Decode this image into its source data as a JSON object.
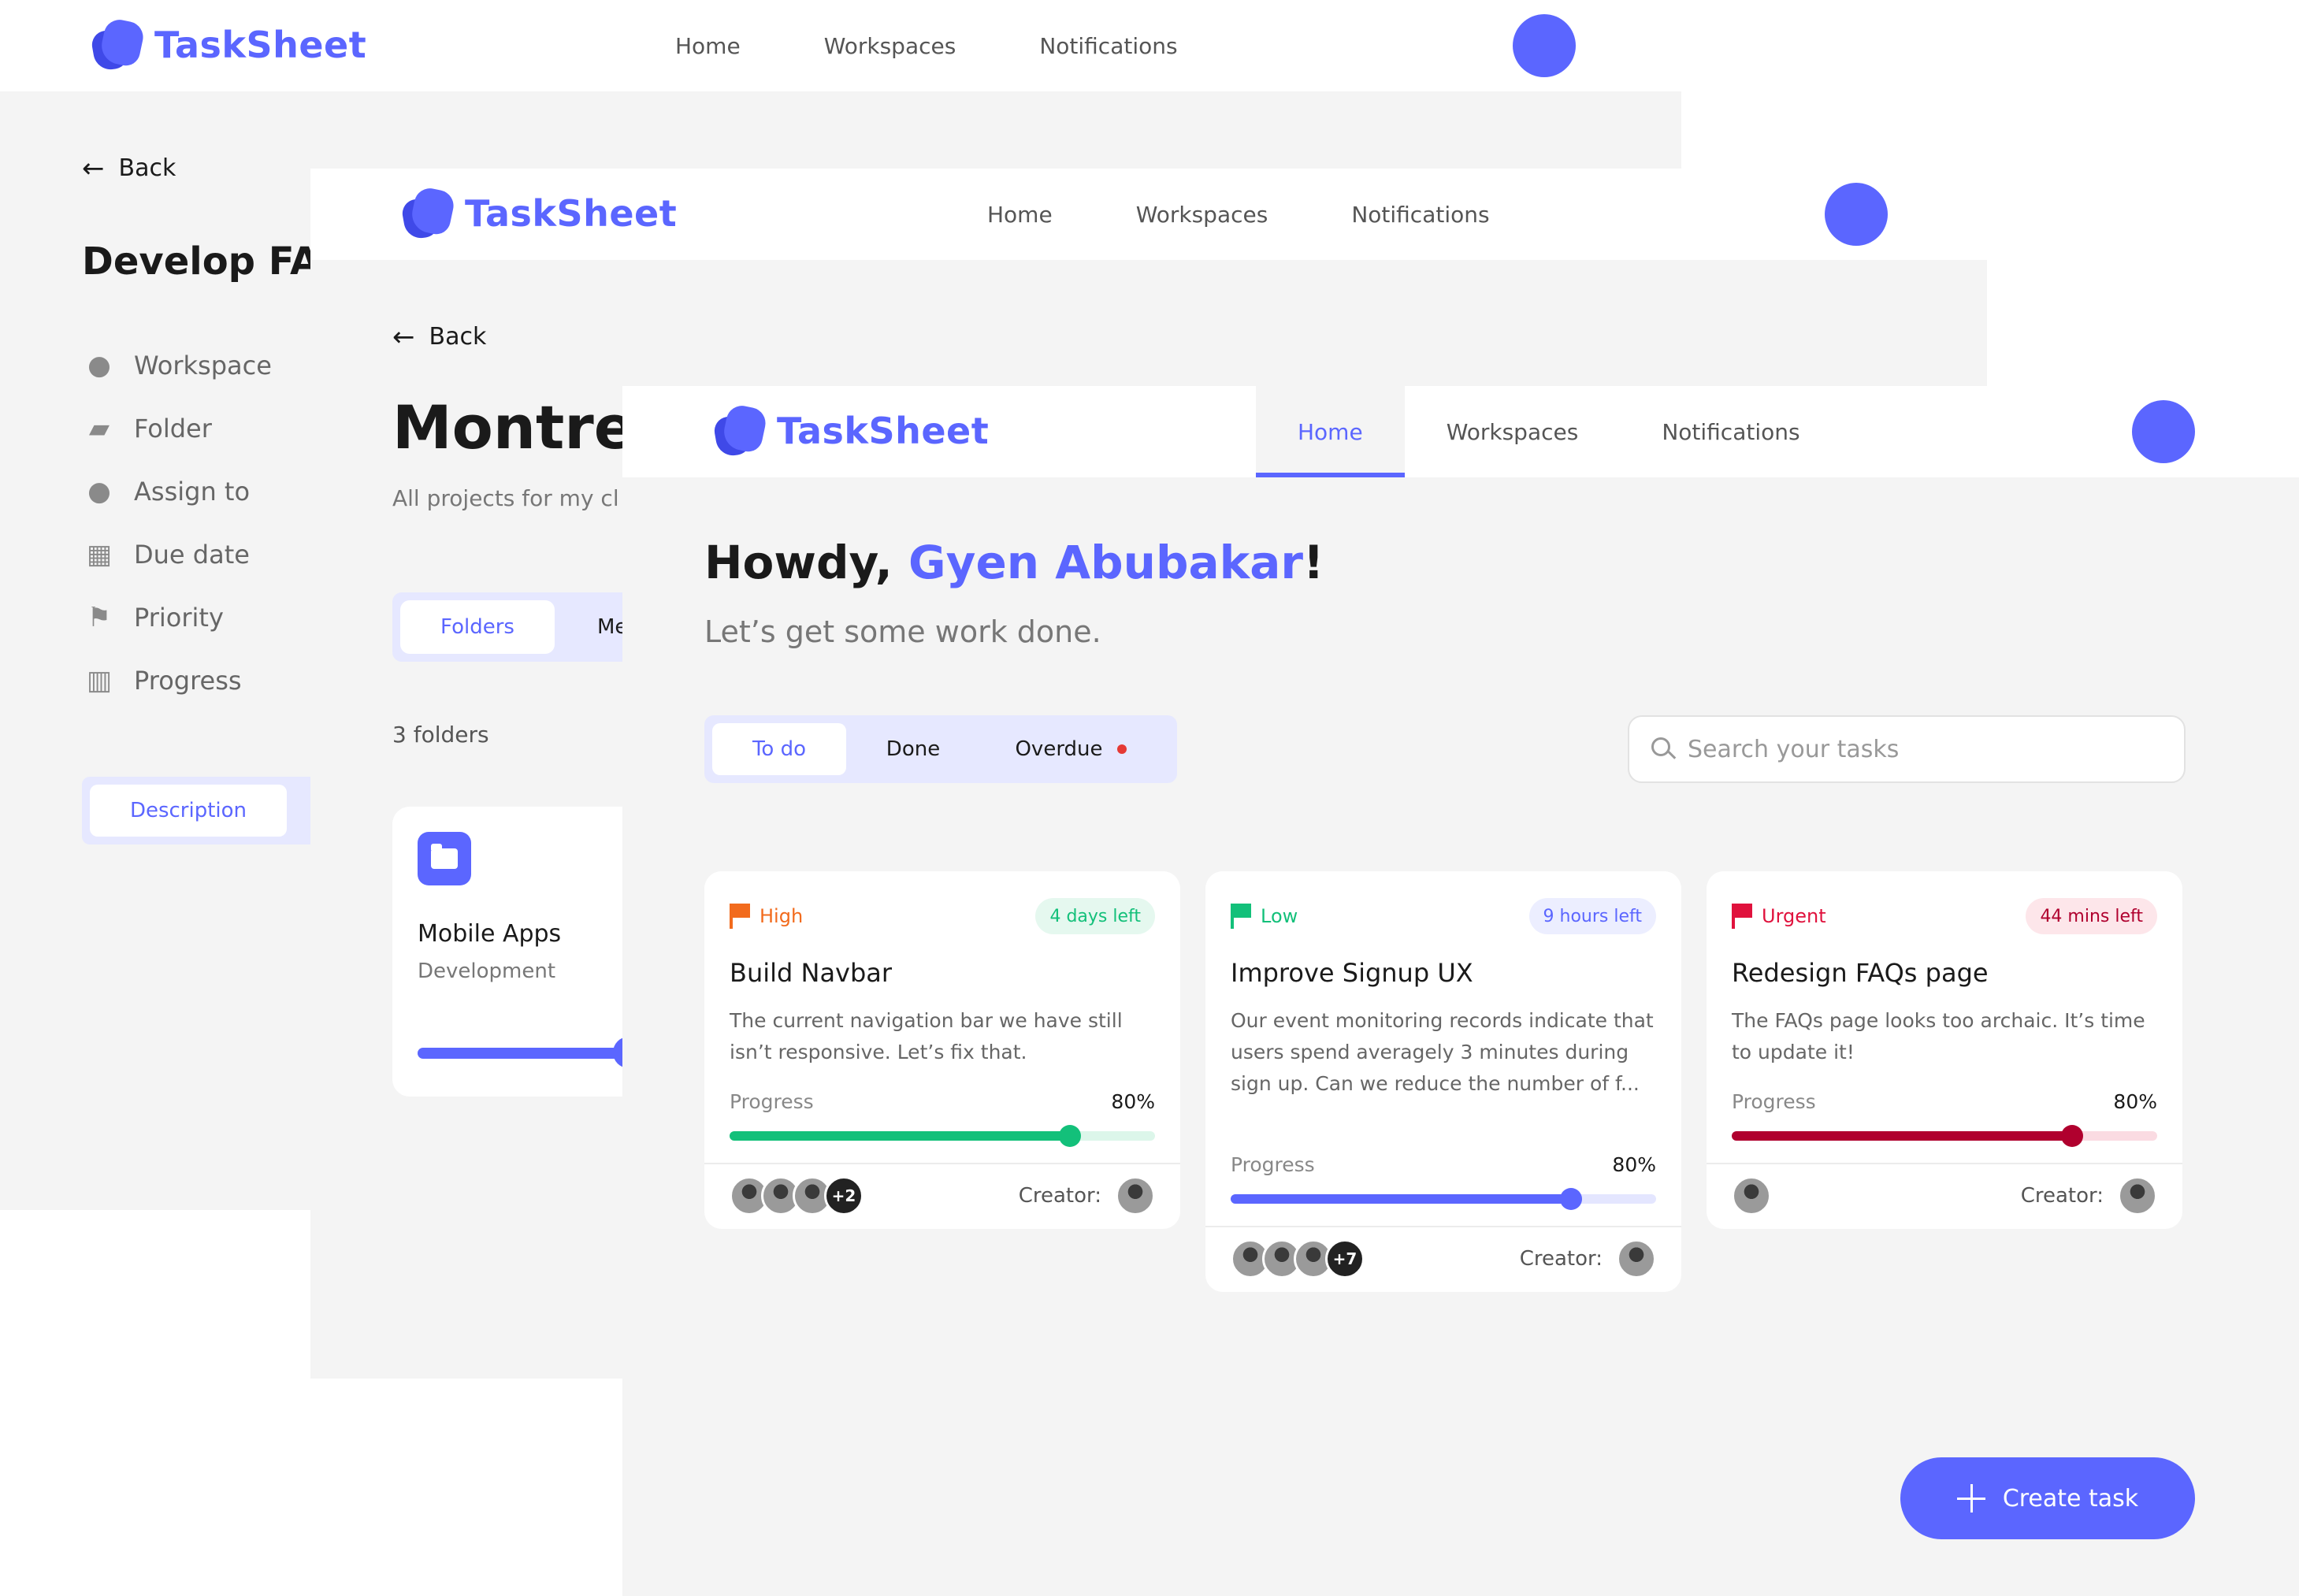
{
  "colors": {
    "brand": "#5b66ff",
    "high": "#f26b1d",
    "low": "#13c07a",
    "urgent": "#e0123d",
    "background": "#f4f4f4"
  },
  "screens": [
    {
      "nav": {
        "logo": "TaskSheet",
        "links": [
          "Home",
          "Workspaces",
          "Notifications"
        ]
      },
      "back_label": "Back",
      "title": "Develop FAQ",
      "menu": [
        {
          "icon": "people-icon",
          "label": "Workspace"
        },
        {
          "icon": "folder-icon",
          "label": "Folder"
        },
        {
          "icon": "user-icon",
          "label": "Assign to"
        },
        {
          "icon": "calendar-icon",
          "label": "Due date"
        },
        {
          "icon": "flag-icon",
          "label": "Priority"
        },
        {
          "icon": "bar-chart-icon",
          "label": "Progress"
        }
      ],
      "tab_active": "Description"
    },
    {
      "nav": {
        "logo": "TaskSheet",
        "links": [
          "Home",
          "Workspaces",
          "Notifications"
        ]
      },
      "back_label": "Back",
      "title": "Montrea",
      "subtitle": "All projects for my cl",
      "tab_active": "Folders",
      "tab_other": "Me",
      "folder_count": "3 folders",
      "folder": {
        "name": "Mobile Apps",
        "category": "Development",
        "progress": 0.67
      }
    },
    {
      "nav": {
        "logo": "TaskSheet",
        "links": [
          "Home",
          "Workspaces",
          "Notifications"
        ],
        "active": "Home"
      },
      "greeting": {
        "prefix": "Howdy, ",
        "name": "Gyen Abubakar",
        "suffix": "!"
      },
      "subtitle": "Let’s get some work done.",
      "tabs": [
        "To do",
        "Done",
        "Overdue"
      ],
      "search_placeholder": "Search your tasks",
      "tasks": [
        {
          "priority": "High",
          "due": "4 days left",
          "title": "Build Navbar",
          "description": "The current navigation bar we have still isn’t responsive. Let’s fix that.",
          "progress_label": "Progress",
          "progress_value": "80%",
          "progress": 0.8,
          "extra_assignees": "+2",
          "creator_label": "Creator:"
        },
        {
          "priority": "Low",
          "due": "9 hours left",
          "title": "Improve Signup UX",
          "description": "Our event monitoring records indicate that users spend averagely 3 minutes during sign up. Can we reduce the number of f...",
          "progress_label": "Progress",
          "progress_value": "80%",
          "progress": 0.8,
          "extra_assignees": "+7",
          "creator_label": "Creator:"
        },
        {
          "priority": "Urgent",
          "due": "44 mins left",
          "title": "Redesign FAQs page",
          "description": "The FAQs page looks too archaic. It’s time to update it!",
          "progress_label": "Progress",
          "progress_value": "80%",
          "progress": 0.8,
          "creator_label": "Creator:"
        }
      ],
      "create_button": "Create task"
    }
  ]
}
